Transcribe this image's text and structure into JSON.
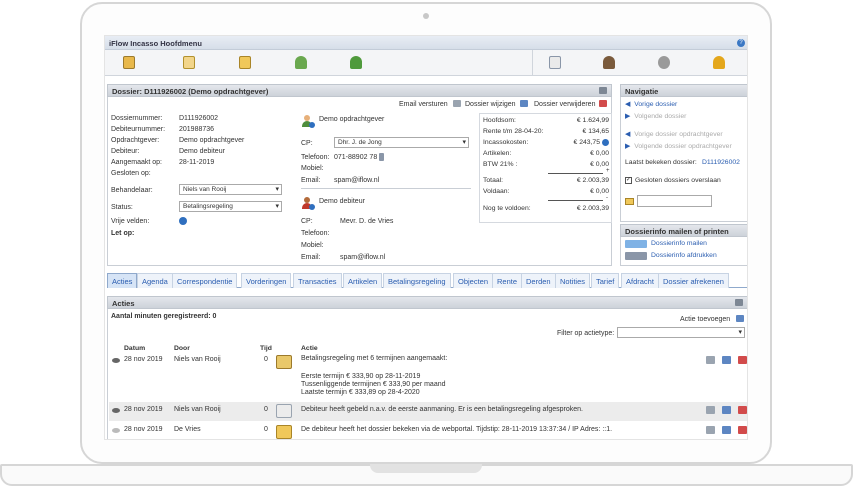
{
  "app": {
    "title": "iFlow Incasso Hoofdmenu",
    "help_icon": "?"
  },
  "toolbar": {
    "icons": [
      "desk-icon",
      "search-folder-icon",
      "open-folder-icon",
      "search-user-icon",
      "add-user-icon",
      "calendar-icon",
      "user-tie-icon",
      "gear-icon",
      "key-icon"
    ]
  },
  "dossier": {
    "title": "Dossier: D111926002 (Demo opdrachtgever)",
    "actions": {
      "email": "Email versturen",
      "edit": "Dossier wijzigen",
      "delete": "Dossier verwijderen"
    },
    "fields": {
      "dossiernummer_label": "Dossiernummer:",
      "dossiernummer": "D111926002",
      "debiteurnummer_label": "Debiteurnummer:",
      "debiteurnummer": "201988736",
      "opdrachtgever_label": "Opdrachtgever:",
      "opdrachtgever": "Demo opdrachtgever",
      "debiteur_label": "Debiteur:",
      "debiteur": "Demo debiteur",
      "aangemaakt_label": "Aangemaakt op:",
      "aangemaakt": "28-11-2019",
      "gesloten_label": "Gesloten op:",
      "behandelaar_label": "Behandelaar:",
      "behandelaar": "Niels van Rooij",
      "status_label": "Status:",
      "status": "Betalingsregeling",
      "vrije_label": "Vrije velden:",
      "letop_label": "Let op:"
    },
    "client": {
      "name": "Demo opdrachtgever",
      "cp_label": "CP:",
      "cp": "Dhr. J. de Jong",
      "telefoon_label": "Telefoon:",
      "telefoon": "071-88902 78",
      "mobiel_label": "Mobiel:",
      "email_label": "Email:",
      "email": "spam@iflow.nl"
    },
    "debtor": {
      "name": "Demo debiteur",
      "cp_label": "CP:",
      "cp": "Mevr. D. de Vries",
      "telefoon_label": "Telefoon:",
      "mobiel_label": "Mobiel:",
      "email_label": "Email:",
      "email": "spam@iflow.nl"
    },
    "totals": [
      {
        "k": "Hoofdsom:",
        "v": "€ 1.624,99"
      },
      {
        "k": "Rente t/m 28-04-20:",
        "v": "€ 134,65"
      },
      {
        "k": "Incassokosten:",
        "v": "€ 243,75"
      },
      {
        "k": "Artikelen:",
        "v": "€ 0,00"
      },
      {
        "k": "BTW 21% :",
        "v": "€ 0,00"
      },
      {
        "k": "Totaal:",
        "v": "€ 2.003,39"
      },
      {
        "k": "Voldaan:",
        "v": "€ 0,00"
      },
      {
        "k": "Nog te voldoen:",
        "v": "€ 2.003,39"
      }
    ],
    "plus_sign": "+",
    "minus_sign": "-"
  },
  "navigatie": {
    "title": "Navigatie",
    "vorige": "Vorige dossier",
    "volgende": "Volgende dossier",
    "vorige_geselecteerd": "Vorige dossier opdrachtgever",
    "volgende_geselecteerd": "Volgende dossier opdrachtgever",
    "laatst_label": "Laatst bekeken dossier:",
    "laatst": "D111926002",
    "overslaan": "Gesloten dossiers overslaan"
  },
  "mail": {
    "title": "Dossierinfo mailen of printen",
    "mailen": "Dossierinfo mailen",
    "afdrukken": "Dossierinfo afdrukken"
  },
  "tabs": [
    "Acties",
    "Agenda",
    "Correspondentie",
    "Vorderingen",
    "Transacties",
    "Artikelen",
    "Betalingsregeling",
    "Objecten",
    "Rente",
    "Derden",
    "Notities",
    "Tarief",
    "Afdracht",
    "Dossier afrekenen"
  ],
  "acties": {
    "title": "Acties",
    "minuten": "Aantal minuten geregistreerd: 0",
    "toevoegen": "Actie toevoegen",
    "filter_label": "Filter op actietype:",
    "columns": {
      "datum": "Datum",
      "door": "Door",
      "tijd": "Tijd",
      "actie": "Actie"
    },
    "rows": [
      {
        "datum": "28 nov 2019",
        "door": "Niels van Rooij",
        "tijd": "0",
        "actie": [
          "Betalingsregeling met 6 termijnen aangemaakt:",
          "",
          "Eerste termijn € 333,90 op 28-11-2019",
          "Tussenliggende termijnen € 333,90 per maand",
          "Laatste termijn € 333,89 op 28-4-2020"
        ]
      },
      {
        "datum": "28 nov 2019",
        "door": "Niels van Rooij",
        "tijd": "0",
        "actie": [
          "Debiteur heeft gebeld n.a.v. de eerste aanmaning. Er is een betalingsregeling afgesproken."
        ]
      },
      {
        "datum": "28 nov 2019",
        "door": "De Vries",
        "tijd": "0",
        "actie": [
          "De debiteur heeft het dossier bekeken via de webportal. Tijdstip: 28-11-2019 13:37:34 / IP Adres: ::1."
        ]
      }
    ]
  },
  "colors": {
    "link": "#2a5db0",
    "tab_bg": "#eef3fa",
    "header_bg": "#d6dee9"
  }
}
